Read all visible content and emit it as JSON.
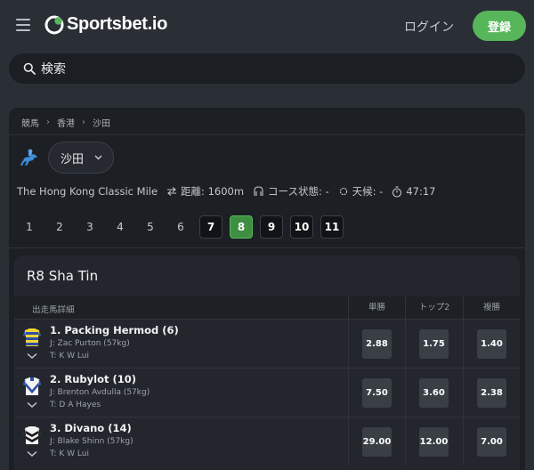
{
  "header": {
    "logo_text": "Sportsbet.io",
    "login_label": "ログイン",
    "register_label": "登録",
    "accent_color": "#58b65a"
  },
  "search": {
    "placeholder": "検索"
  },
  "breadcrumb": [
    "競馬",
    "香港",
    "沙田"
  ],
  "venue": {
    "selected": "沙田"
  },
  "race_info": {
    "name": "The Hong Kong Classic Mile",
    "distance": "距離: 1600m",
    "course": "コース状態: -",
    "weather": "天候: -",
    "countdown": "47:17"
  },
  "pager": {
    "numbers": [
      "1",
      "2",
      "3",
      "4",
      "5",
      "6",
      "7",
      "8",
      "9",
      "10",
      "11"
    ],
    "active": "8"
  },
  "race": {
    "title": "R8 Sha Tin",
    "columns": {
      "runner": "出走馬詳細",
      "win": "単勝",
      "top2": "トップ2",
      "place": "複勝"
    },
    "runners": [
      {
        "name": "1. Packing Hermod (6)",
        "jockey": "J: Zac Purton (57kg)",
        "trainer": "T: K W Lui",
        "win": "2.88",
        "top2": "1.75",
        "place": "1.40",
        "silk_icon": "silk-blue-yellow-hoops-icon"
      },
      {
        "name": "2. Rubylot (10)",
        "jockey": "J: Brenton Avdulla (57kg)",
        "trainer": "T: D A Hayes",
        "win": "7.50",
        "top2": "3.60",
        "place": "2.38",
        "silk_icon": "silk-white-blue-chevron-icon"
      },
      {
        "name": "3. Divano (14)",
        "jockey": "J: Blake Shinn (57kg)",
        "trainer": "T: K W Lui",
        "win": "29.00",
        "top2": "12.00",
        "place": "7.00",
        "silk_icon": "silk-black-white-chevrons-icon"
      }
    ]
  }
}
